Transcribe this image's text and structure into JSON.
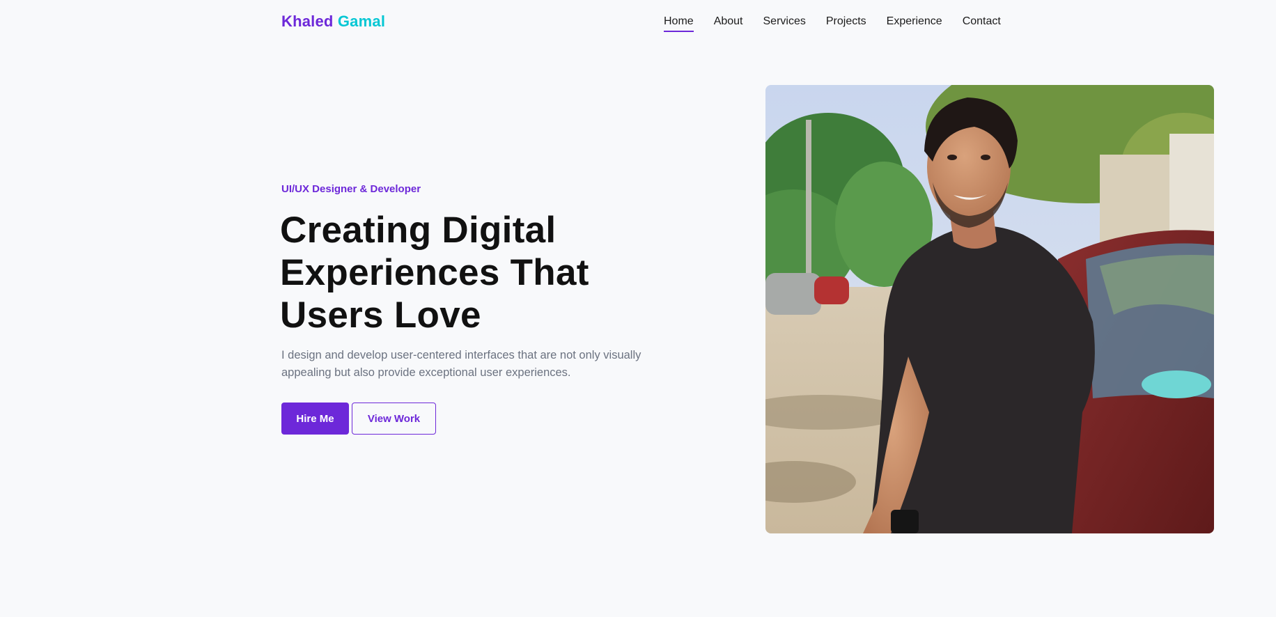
{
  "brand": {
    "first": "Khaled",
    "last": "Gamal"
  },
  "nav": {
    "items": [
      {
        "label": "Home",
        "active": true
      },
      {
        "label": "About"
      },
      {
        "label": "Services"
      },
      {
        "label": "Projects"
      },
      {
        "label": "Experience"
      },
      {
        "label": "Contact"
      }
    ]
  },
  "hero": {
    "eyebrow": "UI/UX Designer & Developer",
    "headline": "Creating Digital Experiences That Users Love",
    "lede": "I design and develop user-centered interfaces that are not only visually appealing but also provide exceptional user experiences.",
    "primary_button": "Hire Me",
    "secondary_button": "View Work"
  },
  "colors": {
    "accent": "#6d28d9",
    "accent_secondary": "#06c7d4",
    "background": "#f8f9fb"
  }
}
